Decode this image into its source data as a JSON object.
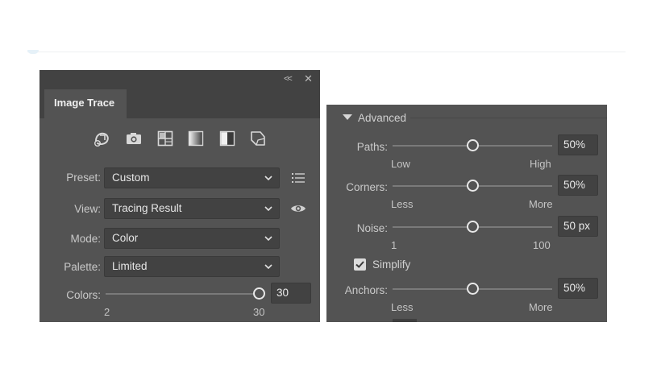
{
  "panel": {
    "tab_label": "Image Trace",
    "presets_row": [
      "auto-color-preset-icon",
      "high-color-photo-icon",
      "low-color-grid-icon",
      "grayscale-gradient-icon",
      "black-white-half-icon",
      "outline-shape-icon"
    ],
    "preset": {
      "label": "Preset:",
      "value": "Custom"
    },
    "view": {
      "label": "View:",
      "value": "Tracing Result"
    },
    "mode": {
      "label": "Mode:",
      "value": "Color"
    },
    "palette": {
      "label": "Palette:",
      "value": "Limited"
    },
    "colors": {
      "label": "Colors:",
      "value": "30",
      "min_label": "2",
      "max_label": "30",
      "min": 2,
      "max": 30,
      "current": 30
    }
  },
  "advanced": {
    "header": "Advanced",
    "paths": {
      "label": "Paths:",
      "value": "50%",
      "low_label": "Low",
      "high_label": "High",
      "fraction": 0.5
    },
    "corners": {
      "label": "Corners:",
      "value": "50%",
      "low_label": "Less",
      "high_label": "More",
      "fraction": 0.5
    },
    "noise": {
      "label": "Noise:",
      "value": "50 px",
      "low_label": "1",
      "high_label": "100",
      "fraction": 0.5
    },
    "simplify": {
      "label": "Simplify",
      "checked": true
    },
    "anchors": {
      "label": "Anchors:",
      "value": "50%",
      "low_label": "Less",
      "high_label": "More",
      "fraction": 0.5
    }
  },
  "colors": {
    "panel_bg": "#535353",
    "field_bg": "#424242",
    "text": "#c9c9c9"
  }
}
